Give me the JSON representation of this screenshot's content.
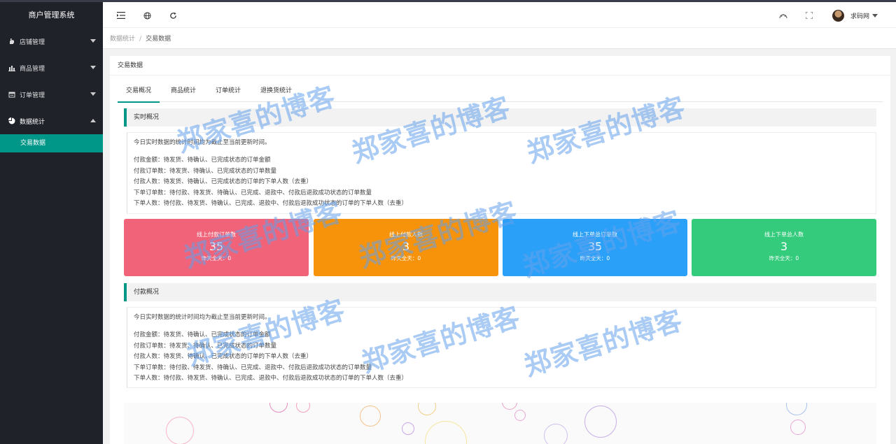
{
  "app": {
    "title": "商户管理系统"
  },
  "sidebar": {
    "items": [
      {
        "label": "店铺管理",
        "icon": "hand-icon"
      },
      {
        "label": "商品管理",
        "icon": "bar-chart-icon"
      },
      {
        "label": "订单管理",
        "icon": "calendar-icon"
      },
      {
        "label": "数据统计",
        "icon": "pie-chart-icon"
      }
    ],
    "sub_items": [
      {
        "label": "交易数据"
      }
    ]
  },
  "header": {
    "user_name": "求码网",
    "icons": [
      "menu-fold-icon",
      "globe-icon",
      "refresh-icon",
      "theme-icon",
      "fullscreen-icon"
    ]
  },
  "breadcrumb": {
    "parent": "数据统计",
    "separator": "/",
    "current": "交易数据"
  },
  "card": {
    "title": "交易数据"
  },
  "tabs": [
    {
      "label": "交易概况"
    },
    {
      "label": "商品统计"
    },
    {
      "label": "订单统计"
    },
    {
      "label": "退换货统计"
    }
  ],
  "realtime": {
    "title": "实时概况",
    "lines": [
      "今日实时数据的统计时间均为截止至当前更新时间。",
      "付款金额：待发货、待确认、已完成状态的订单金额",
      "付款订单数：待发货、待确认、已完成状态的订单数量",
      "付款人数：待发货、待确认、已完成状态的订单的下单人数（去重）",
      "下单订单数：待付款、待发货、待确认、已完成、退款中、付款后退款成功状态的订单数量",
      "下单人数：待付款、待发货、待确认、已完成、退款中、付款后退款成功状态的订单的下单人数（去重）"
    ]
  },
  "stats": [
    {
      "label": "线上付款订单数",
      "value": "35",
      "foot": "昨天全天：0",
      "color": "#f06379"
    },
    {
      "label": "线上付款人数",
      "value": "3",
      "foot": "昨天全天：0",
      "color": "#f7930a"
    },
    {
      "label": "线上下单总订单数",
      "value": "35",
      "foot": "昨天全天：0",
      "color": "#2aa0f8"
    },
    {
      "label": "线上下单总人数",
      "value": "3",
      "foot": "昨天全天：0",
      "color": "#35cb7d"
    }
  ],
  "payment": {
    "title": "付款概况",
    "lines": [
      "今日实时数据的统计时间均为截止至当前更新时间。",
      "付款金额：待发货、待确认、已完成状态的订单金额",
      "付款订单数：待发货、待确认、已完成状态的订单数量",
      "付款人数：待发货、待确认、已完成状态的订单的下单人数（去重）",
      "下单订单数：待付款、待发货、待确认、已完成、退款中、付款后退款成功状态的订单数量",
      "下单人数：待付款、待发货、待确认、已完成、退款中、付款后退款成功状态的订单的下单人数（去重）"
    ]
  },
  "watermark": {
    "text": "郑家喜的博客"
  },
  "colors": {
    "accent": "#009688",
    "sidebar": "#20222a"
  }
}
